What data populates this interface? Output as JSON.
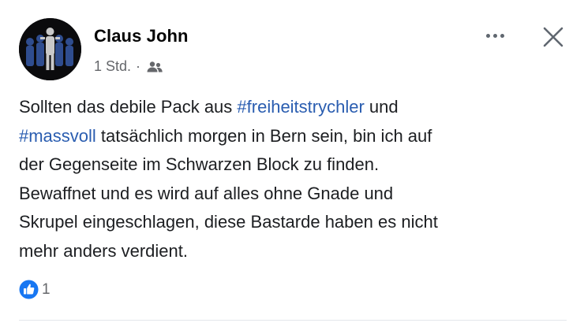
{
  "post": {
    "author": "Claus John",
    "timestamp": "1 Std.",
    "separator": "·",
    "audience_icon": "friends-icon",
    "body_lines": [
      [
        {
          "text": "Sollten das debile Pack aus ",
          "hashtag": false
        },
        {
          "text": "#freiheitstrychler",
          "hashtag": true
        },
        {
          "text": " und",
          "hashtag": false
        }
      ],
      [
        {
          "text": "#massvoll",
          "hashtag": true
        },
        {
          "text": " tatsächlich morgen in Bern sein, bin ich auf",
          "hashtag": false
        }
      ],
      [
        {
          "text": "der Gegenseite im Schwarzen Block zu finden.",
          "hashtag": false
        }
      ],
      [
        {
          "text": "Bewaffnet und es wird auf alles ohne Gnade und",
          "hashtag": false
        }
      ],
      [
        {
          "text": "Skrupel eingeschlagen, diese Bastarde haben es nicht",
          "hashtag": false
        }
      ],
      [
        {
          "text": "mehr anders verdient.",
          "hashtag": false
        }
      ]
    ],
    "reactions": {
      "icon": "like-icon",
      "count": "1"
    }
  },
  "colors": {
    "hashtag": "#2a5db0",
    "meta_text": "#65676b",
    "like_blue": "#1877f2",
    "icon_gray": "#606770"
  }
}
